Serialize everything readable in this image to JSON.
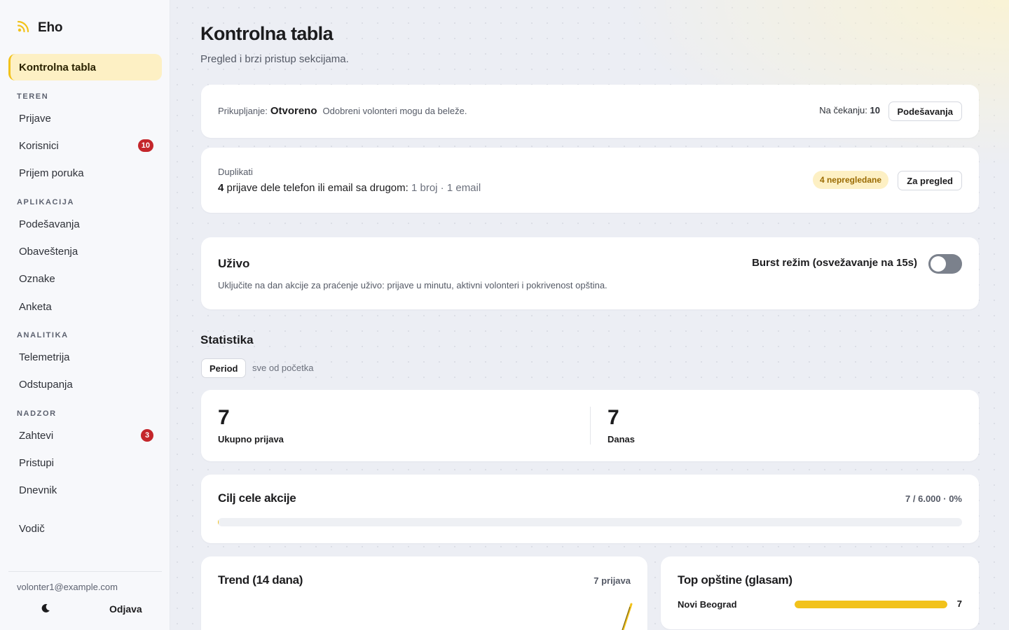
{
  "brand": {
    "name": "Eho",
    "icon": "rss-icon",
    "accent": "#f2c21b"
  },
  "sidebar": {
    "active": "Kontrolna tabla",
    "sections": [
      {
        "title": "TEREN",
        "items": [
          {
            "label": "Prijave"
          },
          {
            "label": "Korisnici",
            "badge": "10"
          },
          {
            "label": "Prijem poruka"
          }
        ]
      },
      {
        "title": "APLIKACIJA",
        "items": [
          {
            "label": "Podešavanja"
          },
          {
            "label": "Obaveštenja"
          },
          {
            "label": "Oznake"
          },
          {
            "label": "Anketa"
          }
        ]
      },
      {
        "title": "ANALITIKA",
        "items": [
          {
            "label": "Telemetrija"
          },
          {
            "label": "Odstupanja"
          }
        ]
      },
      {
        "title": "NADZOR",
        "items": [
          {
            "label": "Zahtevi",
            "badge": "3"
          },
          {
            "label": "Pristupi"
          },
          {
            "label": "Dnevnik"
          }
        ]
      }
    ],
    "guide": "Vodič",
    "user_email": "volonter1@example.com",
    "logout": "Odjava",
    "theme_icon": "moon-icon"
  },
  "header": {
    "title": "Kontrolna tabla",
    "subtitle": "Pregled i brzi pristup sekcijama."
  },
  "collection": {
    "label": "Prikupljanje:",
    "status": "Otvoreno",
    "description": "Odobreni volonteri mogu da beleže.",
    "pending_label": "Na čekanju:",
    "pending_count": "10",
    "settings_button": "Podešavanja"
  },
  "duplicates": {
    "title": "Duplikati",
    "count": "4",
    "message": " prijave dele telefon ili email sa drugom: ",
    "detail": "1 broj · 1 email",
    "pill": "4 nepregledane",
    "review_button": "Za pregled"
  },
  "live": {
    "title": "Uživo",
    "description": "Uključite na dan akcije za praćenje uživo: prijave u minutu, aktivni volonteri i pokrivenost opština.",
    "burst_label": "Burst režim (osvežavanje na 15s)",
    "burst_enabled": false
  },
  "stats": {
    "title": "Statistika",
    "period_button": "Period",
    "period_value": "sve od početka",
    "total_value": "7",
    "total_label": "Ukupno prijava",
    "today_value": "7",
    "today_label": "Danas"
  },
  "goal": {
    "title": "Cilj cele akcije",
    "progress_text": "7 / 6.000 · 0%",
    "progress_fraction": 0.0012
  },
  "trend": {
    "title": "Trend (14 dana)",
    "count_label": "7 prijava"
  },
  "top": {
    "title": "Top opštine (glasam)",
    "rows": [
      {
        "name": "Novi Beograd",
        "value": "7",
        "fraction": 1.0
      }
    ]
  }
}
